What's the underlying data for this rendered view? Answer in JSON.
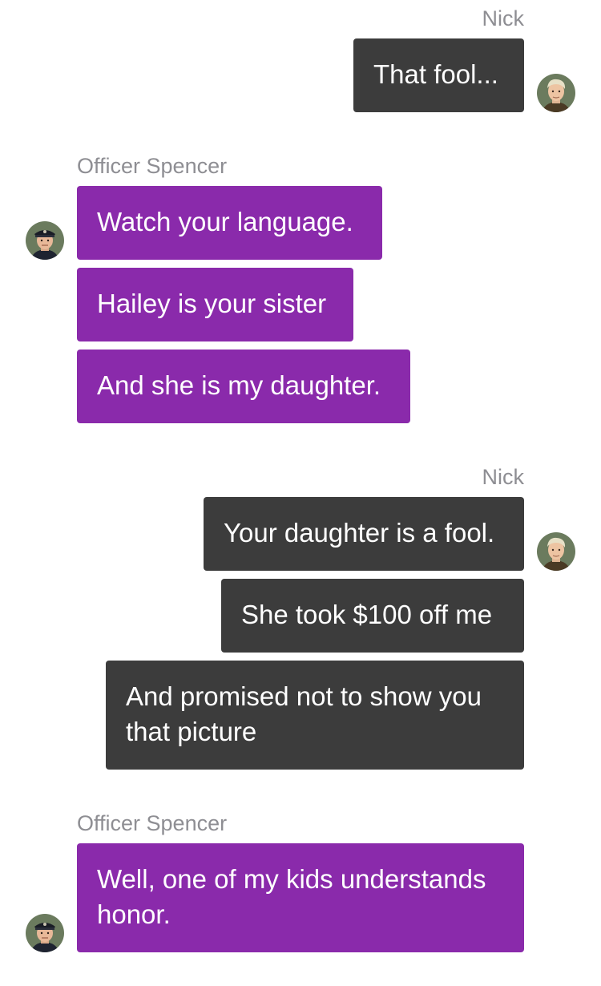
{
  "messages": [
    {
      "sender": "Nick",
      "texts": [
        "That fool..."
      ]
    },
    {
      "sender": "Officer Spencer",
      "texts": [
        "Watch your language.",
        "Hailey is your sister",
        "And she is my daughter."
      ]
    },
    {
      "sender": "Nick",
      "texts": [
        "Your daughter is a fool.",
        "She took $100 off me",
        "And promised not to show you that picture"
      ]
    },
    {
      "sender": "Officer Spencer",
      "texts": [
        "Well, one of my kids understands honor."
      ]
    }
  ],
  "colors": {
    "outgoing_bubble": "#3c3c3c",
    "incoming_bubble": "#8a2aab",
    "sender_label": "#8e8e93",
    "background": "#ffffff"
  },
  "icons": {
    "nick_avatar": "nick-avatar-icon",
    "officer_avatar": "officer-spencer-avatar-icon"
  }
}
